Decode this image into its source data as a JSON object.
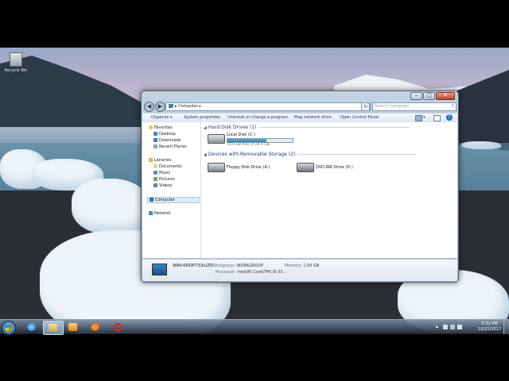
{
  "desktop": {
    "icons": [
      {
        "label": "Recycle Bin",
        "icon": "recycle-bin-icon"
      }
    ]
  },
  "window": {
    "address": {
      "path": "Computer"
    },
    "search": {
      "placeholder": "Search Computer"
    },
    "toolbar": {
      "organize": "Organize",
      "system_properties": "System properties",
      "uninstall": "Uninstall or change a program",
      "map_drive": "Map network drive",
      "control_panel": "Open Control Panel"
    },
    "nav_pane": {
      "favorites": "Favorites",
      "desktop": "Desktop",
      "downloads": "Downloads",
      "recent": "Recent Places",
      "libraries": "Libraries",
      "documents": "Documents",
      "music": "Music",
      "pictures": "Pictures",
      "videos": "Videos",
      "computer": "Computer",
      "network": "Network"
    },
    "groups": {
      "hdd": "Hard Disk Drives (1)",
      "removable": "Devices with Removable Storage (2)"
    },
    "drives": {
      "c": {
        "name": "Local Disk (C:)",
        "free": "10.0 GB free of 24.9 GB",
        "used_fraction": 0.6
      },
      "a": {
        "name": "Floppy Disk Drive (A:)"
      },
      "d": {
        "name": "DVD RW Drive (D:)"
      }
    },
    "details": {
      "name": "WIN-6RDP733LIZ5",
      "workgroup_label": "Workgroup:",
      "workgroup": "WORKGROUP",
      "memory_label": "Memory:",
      "memory": "1.00 GB",
      "processor_label": "Processor:",
      "processor": "Intel(R) Core(TM) i5-33..."
    }
  },
  "taskbar": {
    "apps": [
      "internet-explorer-icon",
      "file-explorer-icon",
      "media-player-icon",
      "firefox-icon",
      "opera-icon"
    ],
    "clock": {
      "time": "5:32 PM",
      "date": "10/21/2017"
    }
  }
}
